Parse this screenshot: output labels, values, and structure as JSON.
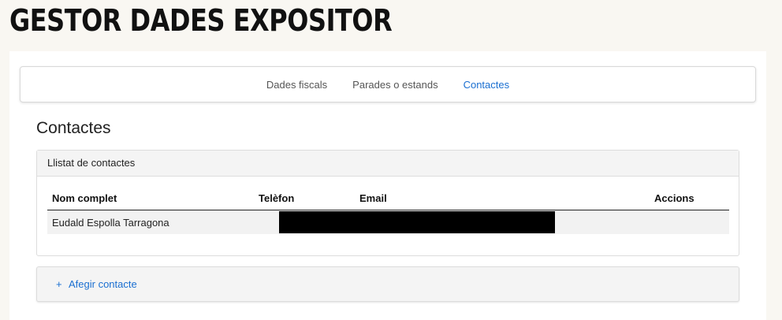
{
  "app": {
    "title": "GESTOR DADES EXPOSITOR"
  },
  "nav": {
    "tabs": [
      {
        "label": "Dades fiscals",
        "active": false
      },
      {
        "label": "Parades o estands",
        "active": false
      },
      {
        "label": "Contactes",
        "active": true
      }
    ]
  },
  "section": {
    "title": "Contactes",
    "list_header": "Llistat de contactes"
  },
  "table": {
    "columns": [
      "Nom complet",
      "Telèfon",
      "Email",
      "Accions"
    ],
    "rows": [
      {
        "name": "Eudald Espolla Tarragona",
        "phone": "",
        "email": "",
        "actions": ""
      }
    ]
  },
  "add": {
    "icon": "plus-icon",
    "label": "Afegir contacte"
  },
  "colors": {
    "accent": "#1a6fd1",
    "background": "#f9f7f2"
  }
}
